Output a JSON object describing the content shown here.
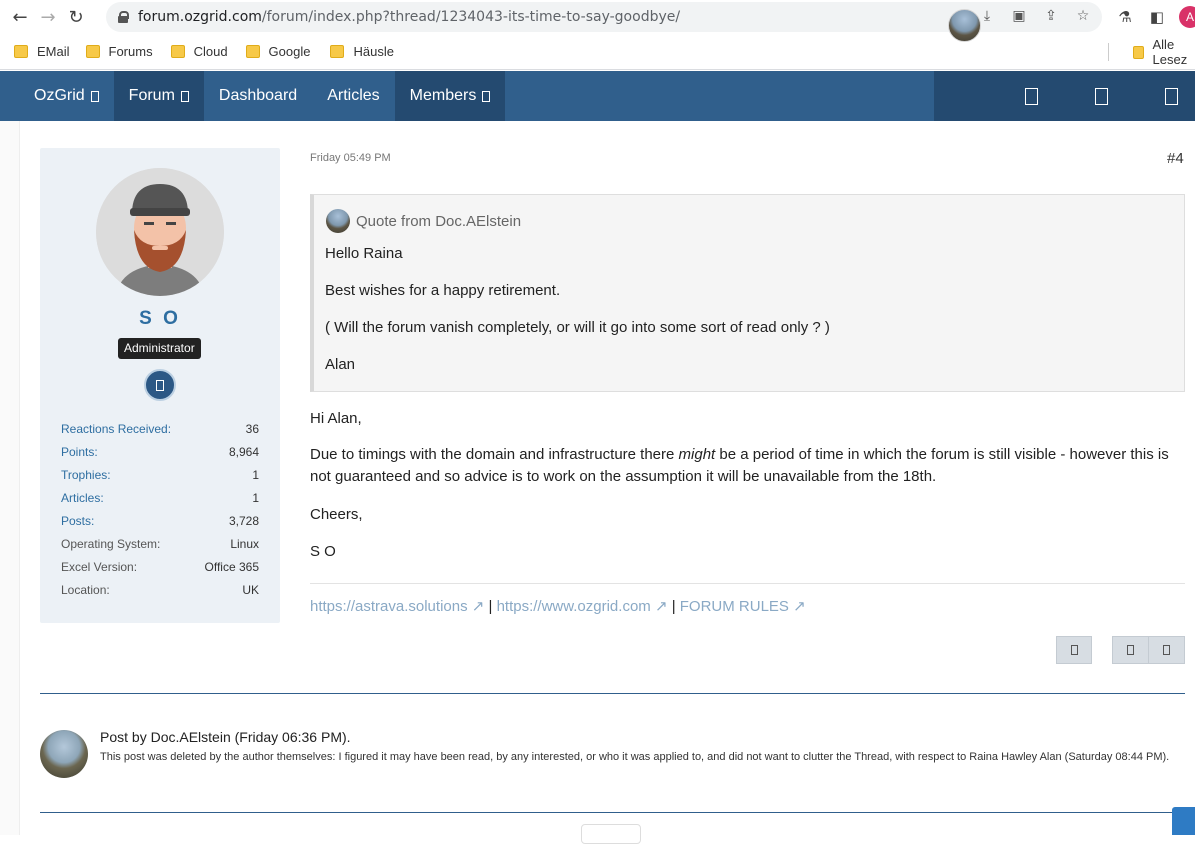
{
  "browser": {
    "url_host": "forum.ozgrid.com",
    "url_path": "/forum/index.php?thread/1234043-its-time-to-say-goodbye/",
    "profile_initial": "A",
    "bookmarks": [
      "EMail",
      "Forums",
      "Cloud",
      "Google",
      "Häusle"
    ],
    "all_bookmarks": "Alle Lesez"
  },
  "nav": {
    "items": [
      "OzGrid",
      "Forum",
      "Dashboard",
      "Articles",
      "Members"
    ],
    "active": "Forum"
  },
  "user": {
    "name": "S O",
    "rank": "Administrator",
    "stats": [
      {
        "label": "Reactions Received:",
        "value": "36",
        "link": true
      },
      {
        "label": "Points:",
        "value": "8,964",
        "link": true
      },
      {
        "label": "Trophies:",
        "value": "1",
        "link": true
      },
      {
        "label": "Articles:",
        "value": "1",
        "link": true
      },
      {
        "label": "Posts:",
        "value": "3,728",
        "link": true
      },
      {
        "label": "Operating System:",
        "value": "Linux",
        "link": false
      },
      {
        "label": "Excel Version:",
        "value": "Office 365",
        "link": false
      },
      {
        "label": "Location:",
        "value": "UK",
        "link": false
      }
    ]
  },
  "post": {
    "date": "Friday 05:49 PM",
    "number": "#4",
    "quote": {
      "title": "Quote from Doc.AElstein",
      "lines": [
        "Hello Raina",
        "Best wishes for a happy retirement.",
        "( Will the forum vanish completely, or will it go into some sort of read only ? )",
        "Alan"
      ]
    },
    "greeting": "Hi Alan,",
    "para_before": "Due to timings with the domain and infrastructure there ",
    "para_em": "might",
    "para_after": " be a period of time in which the forum is still visible - however this is not guaranteed and so advice is to work on the assumption it will be unavailable from the 18th.",
    "closing": "Cheers,",
    "signoff": "S O",
    "signature": {
      "link1": "https://astrava.solutions ↗",
      "sep1": " | ",
      "link2": "https://www.ozgrid.com ↗",
      "sep2": " | ",
      "link3": "FORUM RULES ↗"
    }
  },
  "deleted": {
    "title": "Post by Doc.AElstein (Friday 06:36 PM).",
    "text": "This post was deleted by the author themselves: I figured it may have been read, by any interested, or who it was applied to, and did not want to clutter the Thread, with respect to Raina Hawley Alan (Saturday 08:44 PM)."
  }
}
